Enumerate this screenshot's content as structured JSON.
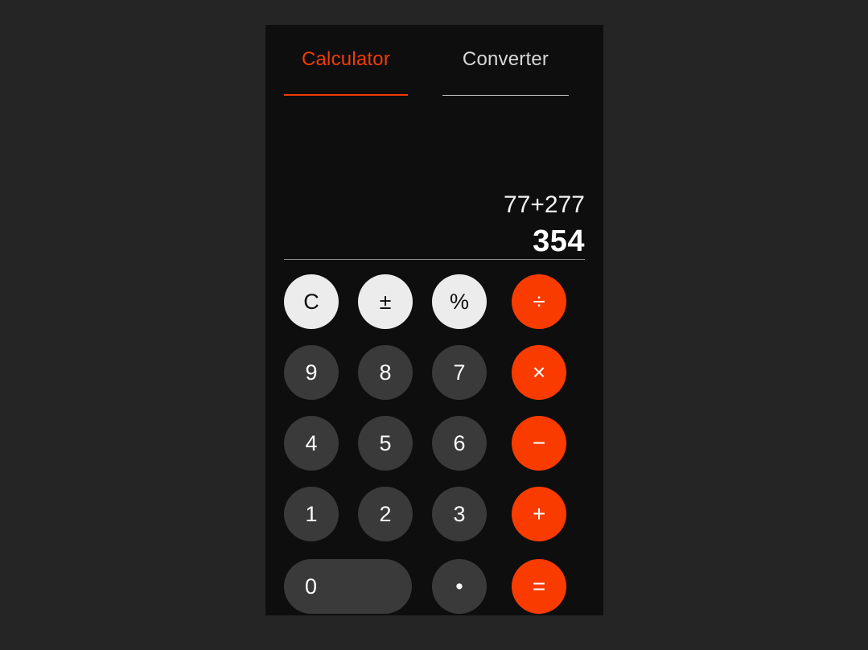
{
  "app": {
    "title": "Calculator",
    "accent_color": "#fa3b00",
    "panel_background": "#0e0e0e",
    "page_background": "#252525",
    "light_key_color": "#ececec",
    "dark_key_color": "#3a3a3a"
  },
  "tabs": [
    {
      "id": "calculator",
      "label": "Calculator",
      "active": true
    },
    {
      "id": "converter",
      "label": "Converter",
      "active": false
    }
  ],
  "display": {
    "expression": "77+277",
    "result": "354"
  },
  "keypad": {
    "rows": [
      [
        {
          "id": "clear",
          "label": "C",
          "icon": "clear-icon",
          "style": "light"
        },
        {
          "id": "sign",
          "label": "±",
          "icon": "plus-minus-icon",
          "style": "light"
        },
        {
          "id": "percent",
          "label": "%",
          "icon": "percent-icon",
          "style": "light"
        },
        {
          "id": "divide",
          "label": "÷",
          "icon": "divide-icon",
          "style": "accent"
        }
      ],
      [
        {
          "id": "nine",
          "label": "9",
          "icon": "digit-nine",
          "style": "dark"
        },
        {
          "id": "eight",
          "label": "8",
          "icon": "digit-eight",
          "style": "dark"
        },
        {
          "id": "seven",
          "label": "7",
          "icon": "digit-seven",
          "style": "dark"
        },
        {
          "id": "multiply",
          "label": "×",
          "icon": "multiply-icon",
          "style": "accent"
        }
      ],
      [
        {
          "id": "four",
          "label": "4",
          "icon": "digit-four",
          "style": "dark"
        },
        {
          "id": "five",
          "label": "5",
          "icon": "digit-five",
          "style": "dark"
        },
        {
          "id": "six",
          "label": "6",
          "icon": "digit-six",
          "style": "dark"
        },
        {
          "id": "subtract",
          "label": "−",
          "icon": "minus-icon",
          "style": "accent"
        }
      ],
      [
        {
          "id": "one",
          "label": "1",
          "icon": "digit-one",
          "style": "dark"
        },
        {
          "id": "two",
          "label": "2",
          "icon": "digit-two",
          "style": "dark"
        },
        {
          "id": "three",
          "label": "3",
          "icon": "digit-three",
          "style": "dark"
        },
        {
          "id": "add",
          "label": "+",
          "icon": "plus-icon",
          "style": "accent"
        }
      ],
      [
        {
          "id": "zero",
          "label": "0",
          "icon": "digit-zero",
          "style": "dark"
        },
        {
          "id": "decimal",
          "label": "•",
          "icon": "decimal-icon",
          "style": "dark"
        },
        {
          "id": "equals",
          "label": "=",
          "icon": "equals-icon",
          "style": "accent"
        }
      ]
    ]
  }
}
